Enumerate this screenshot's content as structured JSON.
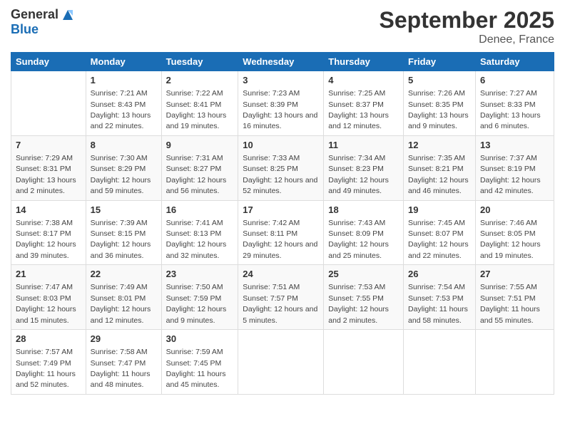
{
  "logo": {
    "general": "General",
    "blue": "Blue"
  },
  "title": {
    "month_year": "September 2025",
    "location": "Denee, France"
  },
  "headers": [
    "Sunday",
    "Monday",
    "Tuesday",
    "Wednesday",
    "Thursday",
    "Friday",
    "Saturday"
  ],
  "weeks": [
    [
      {
        "day": "",
        "sunrise": "",
        "sunset": "",
        "daylight": ""
      },
      {
        "day": "1",
        "sunrise": "Sunrise: 7:21 AM",
        "sunset": "Sunset: 8:43 PM",
        "daylight": "Daylight: 13 hours and 22 minutes."
      },
      {
        "day": "2",
        "sunrise": "Sunrise: 7:22 AM",
        "sunset": "Sunset: 8:41 PM",
        "daylight": "Daylight: 13 hours and 19 minutes."
      },
      {
        "day": "3",
        "sunrise": "Sunrise: 7:23 AM",
        "sunset": "Sunset: 8:39 PM",
        "daylight": "Daylight: 13 hours and 16 minutes."
      },
      {
        "day": "4",
        "sunrise": "Sunrise: 7:25 AM",
        "sunset": "Sunset: 8:37 PM",
        "daylight": "Daylight: 13 hours and 12 minutes."
      },
      {
        "day": "5",
        "sunrise": "Sunrise: 7:26 AM",
        "sunset": "Sunset: 8:35 PM",
        "daylight": "Daylight: 13 hours and 9 minutes."
      },
      {
        "day": "6",
        "sunrise": "Sunrise: 7:27 AM",
        "sunset": "Sunset: 8:33 PM",
        "daylight": "Daylight: 13 hours and 6 minutes."
      }
    ],
    [
      {
        "day": "7",
        "sunrise": "Sunrise: 7:29 AM",
        "sunset": "Sunset: 8:31 PM",
        "daylight": "Daylight: 13 hours and 2 minutes."
      },
      {
        "day": "8",
        "sunrise": "Sunrise: 7:30 AM",
        "sunset": "Sunset: 8:29 PM",
        "daylight": "Daylight: 12 hours and 59 minutes."
      },
      {
        "day": "9",
        "sunrise": "Sunrise: 7:31 AM",
        "sunset": "Sunset: 8:27 PM",
        "daylight": "Daylight: 12 hours and 56 minutes."
      },
      {
        "day": "10",
        "sunrise": "Sunrise: 7:33 AM",
        "sunset": "Sunset: 8:25 PM",
        "daylight": "Daylight: 12 hours and 52 minutes."
      },
      {
        "day": "11",
        "sunrise": "Sunrise: 7:34 AM",
        "sunset": "Sunset: 8:23 PM",
        "daylight": "Daylight: 12 hours and 49 minutes."
      },
      {
        "day": "12",
        "sunrise": "Sunrise: 7:35 AM",
        "sunset": "Sunset: 8:21 PM",
        "daylight": "Daylight: 12 hours and 46 minutes."
      },
      {
        "day": "13",
        "sunrise": "Sunrise: 7:37 AM",
        "sunset": "Sunset: 8:19 PM",
        "daylight": "Daylight: 12 hours and 42 minutes."
      }
    ],
    [
      {
        "day": "14",
        "sunrise": "Sunrise: 7:38 AM",
        "sunset": "Sunset: 8:17 PM",
        "daylight": "Daylight: 12 hours and 39 minutes."
      },
      {
        "day": "15",
        "sunrise": "Sunrise: 7:39 AM",
        "sunset": "Sunset: 8:15 PM",
        "daylight": "Daylight: 12 hours and 36 minutes."
      },
      {
        "day": "16",
        "sunrise": "Sunrise: 7:41 AM",
        "sunset": "Sunset: 8:13 PM",
        "daylight": "Daylight: 12 hours and 32 minutes."
      },
      {
        "day": "17",
        "sunrise": "Sunrise: 7:42 AM",
        "sunset": "Sunset: 8:11 PM",
        "daylight": "Daylight: 12 hours and 29 minutes."
      },
      {
        "day": "18",
        "sunrise": "Sunrise: 7:43 AM",
        "sunset": "Sunset: 8:09 PM",
        "daylight": "Daylight: 12 hours and 25 minutes."
      },
      {
        "day": "19",
        "sunrise": "Sunrise: 7:45 AM",
        "sunset": "Sunset: 8:07 PM",
        "daylight": "Daylight: 12 hours and 22 minutes."
      },
      {
        "day": "20",
        "sunrise": "Sunrise: 7:46 AM",
        "sunset": "Sunset: 8:05 PM",
        "daylight": "Daylight: 12 hours and 19 minutes."
      }
    ],
    [
      {
        "day": "21",
        "sunrise": "Sunrise: 7:47 AM",
        "sunset": "Sunset: 8:03 PM",
        "daylight": "Daylight: 12 hours and 15 minutes."
      },
      {
        "day": "22",
        "sunrise": "Sunrise: 7:49 AM",
        "sunset": "Sunset: 8:01 PM",
        "daylight": "Daylight: 12 hours and 12 minutes."
      },
      {
        "day": "23",
        "sunrise": "Sunrise: 7:50 AM",
        "sunset": "Sunset: 7:59 PM",
        "daylight": "Daylight: 12 hours and 9 minutes."
      },
      {
        "day": "24",
        "sunrise": "Sunrise: 7:51 AM",
        "sunset": "Sunset: 7:57 PM",
        "daylight": "Daylight: 12 hours and 5 minutes."
      },
      {
        "day": "25",
        "sunrise": "Sunrise: 7:53 AM",
        "sunset": "Sunset: 7:55 PM",
        "daylight": "Daylight: 12 hours and 2 minutes."
      },
      {
        "day": "26",
        "sunrise": "Sunrise: 7:54 AM",
        "sunset": "Sunset: 7:53 PM",
        "daylight": "Daylight: 11 hours and 58 minutes."
      },
      {
        "day": "27",
        "sunrise": "Sunrise: 7:55 AM",
        "sunset": "Sunset: 7:51 PM",
        "daylight": "Daylight: 11 hours and 55 minutes."
      }
    ],
    [
      {
        "day": "28",
        "sunrise": "Sunrise: 7:57 AM",
        "sunset": "Sunset: 7:49 PM",
        "daylight": "Daylight: 11 hours and 52 minutes."
      },
      {
        "day": "29",
        "sunrise": "Sunrise: 7:58 AM",
        "sunset": "Sunset: 7:47 PM",
        "daylight": "Daylight: 11 hours and 48 minutes."
      },
      {
        "day": "30",
        "sunrise": "Sunrise: 7:59 AM",
        "sunset": "Sunset: 7:45 PM",
        "daylight": "Daylight: 11 hours and 45 minutes."
      },
      {
        "day": "",
        "sunrise": "",
        "sunset": "",
        "daylight": ""
      },
      {
        "day": "",
        "sunrise": "",
        "sunset": "",
        "daylight": ""
      },
      {
        "day": "",
        "sunrise": "",
        "sunset": "",
        "daylight": ""
      },
      {
        "day": "",
        "sunrise": "",
        "sunset": "",
        "daylight": ""
      }
    ]
  ]
}
